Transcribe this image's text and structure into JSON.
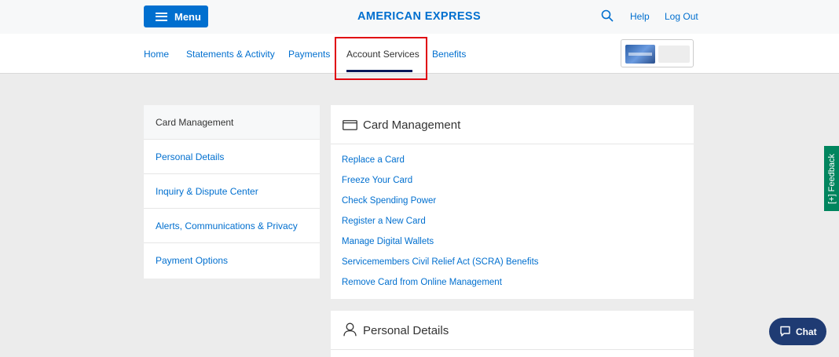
{
  "header": {
    "menu_label": "Menu",
    "brand": "AMERICAN EXPRESS",
    "help_label": "Help",
    "logout_label": "Log Out"
  },
  "nav": {
    "items": [
      "Home",
      "Statements & Activity",
      "Payments",
      "Account Services",
      "Benefits"
    ],
    "active": "Account Services"
  },
  "sidebar": {
    "items": [
      "Card Management",
      "Personal Details",
      "Inquiry & Dispute Center",
      "Alerts, Communications & Privacy",
      "Payment Options"
    ],
    "active": "Card Management"
  },
  "card_management": {
    "title": "Card Management",
    "links": [
      "Replace a Card",
      "Freeze Your Card",
      "Check Spending Power",
      "Register a New Card",
      "Manage Digital Wallets",
      "Servicemembers Civil Relief Act (SCRA) Benefits",
      "Remove Card from Online Management"
    ]
  },
  "personal_details": {
    "title": "Personal Details"
  },
  "feedback_label": "[+] Feedback",
  "chat_label": "Chat",
  "colors": {
    "brand_blue": "#006fcf",
    "navy": "#00175a",
    "highlight_red": "#e0000f",
    "feedback_green": "#00855e",
    "chat_navy": "#1f3b73"
  }
}
